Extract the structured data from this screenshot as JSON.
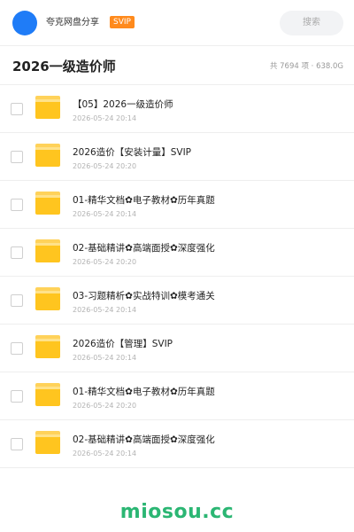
{
  "header": {
    "share_title": "夸克网盘分享",
    "svip_label": "SVIP",
    "search_label": "搜索",
    "avatar_color": "#1f7cf7"
  },
  "folder": {
    "title": "2026一级造价师",
    "meta": "共 7694 项 · 638.0G"
  },
  "items": [
    {
      "name": "【05】2026一级造价师",
      "date": "2026-05-24 20:14",
      "icon": "folder-icon"
    },
    {
      "name": "2026造价【安装计量】SVIP",
      "date": "2026-05-24 20:20",
      "icon": "folder-icon"
    },
    {
      "name": "01-精华文档✿电子教材✿历年真题",
      "date": "2026-05-24 20:14",
      "icon": "folder-icon"
    },
    {
      "name": "02-基础精讲✿高端面授✿深度强化",
      "date": "2026-05-24 20:20",
      "icon": "folder-icon"
    },
    {
      "name": "03-习题精析✿实战特训✿模考通关",
      "date": "2026-05-24 20:14",
      "icon": "folder-icon"
    },
    {
      "name": "2026造价【管理】SVIP",
      "date": "2026-05-24 20:14",
      "icon": "folder-icon"
    },
    {
      "name": "01-精华文档✿电子教材✿历年真题",
      "date": "2026-05-24 20:20",
      "icon": "folder-icon"
    },
    {
      "name": "02-基础精讲✿高端面授✿深度强化",
      "date": "2026-05-24 20:14",
      "icon": "folder-icon"
    }
  ],
  "watermark": "miosou.cc",
  "colors": {
    "accent": "#1f7cf7",
    "svip_badge": "#ff8a1c",
    "folder": "#ffc51f",
    "watermark": "#2bb673"
  }
}
